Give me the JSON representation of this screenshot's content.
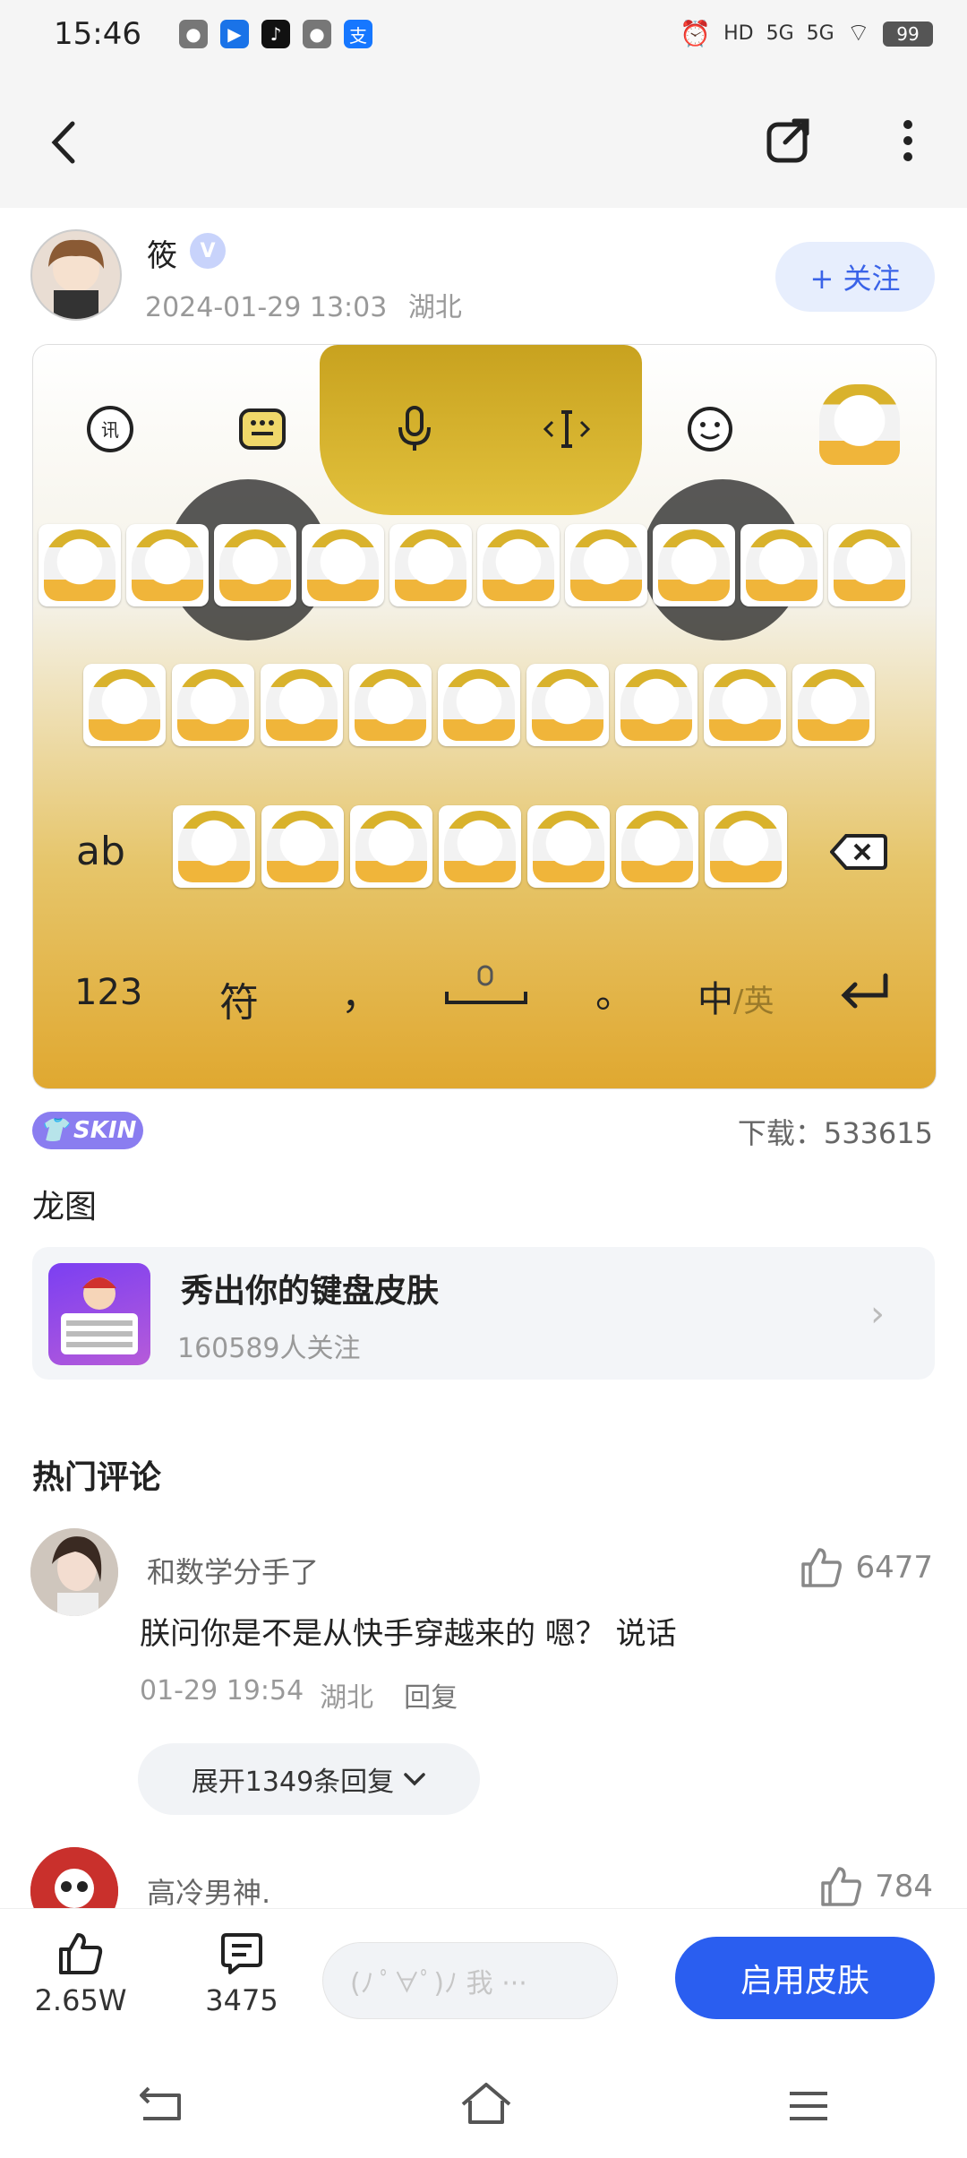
{
  "status": {
    "time": "15:46",
    "hd": "HD",
    "net1": "5G",
    "net2": "5G",
    "battery": "99"
  },
  "nav": {
    "back_icon": "chevron-left-icon",
    "share_icon": "share-icon",
    "more_icon": "more-vertical-icon"
  },
  "author": {
    "name": "筱",
    "verified_label": "V",
    "datetime": "2024-01-29 13:03",
    "location": "湖北",
    "follow_label": "+ 关注"
  },
  "keyboard_preview": {
    "toolbar_icons": [
      "iflytek-icon",
      "keyboard-icon",
      "mic-icon",
      "cursor-icon",
      "emoji-icon",
      "panda-icon"
    ],
    "row1_keys": 10,
    "row2_keys": 9,
    "row3_keys": 7,
    "ab_label": "ab",
    "num_label": "123",
    "symbol_label": "符",
    "comma": "，",
    "period": "。",
    "lang_label": "中",
    "lang_alt": "/英"
  },
  "meta": {
    "skin_badge": "SKIN",
    "download_label": "下载：",
    "download_count": "533615",
    "title": "龙图"
  },
  "topic": {
    "title": "秀出你的键盘皮肤",
    "followers": "160589人关注",
    "arrow": "›"
  },
  "comments": {
    "section_title": "热门评论",
    "items": [
      {
        "name": "和数学分手了",
        "text": "朕问你是不是从快手穿越来的 嗯？ 说话",
        "date": "01-29 19:54",
        "location": "湖北",
        "reply_label": "回复",
        "likes": "6477",
        "expand_label": "展开1349条回复"
      },
      {
        "name": "高冷男神.",
        "likes": "784"
      }
    ]
  },
  "bottom": {
    "like_count": "2.65W",
    "comment_count": "3475",
    "input_placeholder": "(ﾉ ﾟ∀ﾟ)ﾉ 我 ···",
    "apply_label": "启用皮肤"
  },
  "colors": {
    "accent": "#2a5ef0",
    "follow_bg": "#e7eefd",
    "skin_badge": "#8a7df0"
  }
}
